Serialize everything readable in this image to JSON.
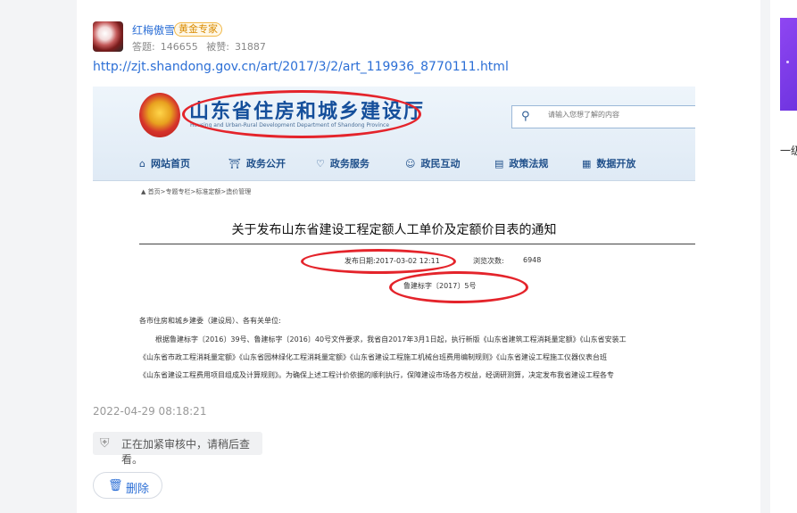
{
  "user": {
    "name": "红梅傲雪",
    "badge": "黄金专家",
    "answers_label": "答题:",
    "answers": "146655",
    "likes_label": "被赞:",
    "likes": "31887"
  },
  "answer": {
    "link": "http://zjt.shandong.gov.cn/art/2017/3/2/art_119936_8770111.html",
    "time": "2022-04-29 08:18:21",
    "review_notice": "正在加紧审核中，请稍后查看。",
    "delete_label": "删除"
  },
  "screenshot": {
    "site_title": "山东省住房和城乡建设厅",
    "site_subtitle": "Housing and Urban-Rural Development Department of Shandong Province",
    "search_placeholder": "请输入您想了解的内容",
    "nav": [
      "网站首页",
      "政务公开",
      "政务服务",
      "政民互动",
      "政策法规",
      "数据开放"
    ],
    "breadcrumb": "首页>专题专栏>标准定额>造价管理",
    "doc_title": "关于发布山东省建设工程定额人工单价及定额价目表的通知",
    "publish_date": "发布日期:2017-03-02 12:11",
    "views_label": "浏览次数:",
    "views": "6948",
    "doc_number": "鲁建标字〔2017〕5号",
    "body_lines": [
      "各市住房和城乡建委（建设局）、各有关单位:",
      "根据鲁建标字〔2016〕39号、鲁建标字〔2016〕40号文件要求，我省自2017年3月1日起，执行新版《山东省建筑工程消耗量定额》《山东省安装工",
      "《山东省市政工程消耗量定额》《山东省园林绿化工程消耗量定额》《山东省建设工程施工机械台班费用编制规则》《山东省建设工程施工仪器仪表台班",
      "《山东省建设工程费用项目组成及计算规则》。为确保上述工程计价依据的顺利执行，保障建设市场各方权益，经调研测算，决定发布我省建设工程各专"
    ]
  },
  "sidebar": {
    "promo_text": "一级"
  },
  "colors": {
    "link": "#2c6fd6",
    "highlight_red": "#e4242b",
    "gov_blue": "#154f9b"
  }
}
